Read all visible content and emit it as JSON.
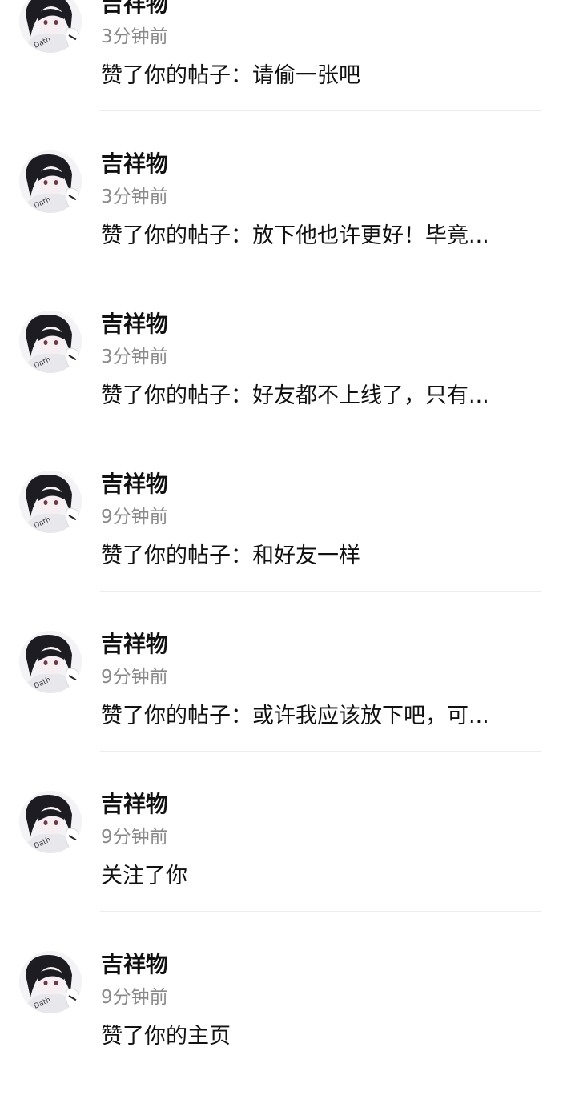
{
  "notifications": [
    {
      "name": "吉祥物",
      "time": "3分钟前",
      "message": "赞了你的帖子：请偷一张吧",
      "avatar_icon": "anime-avatar-icon"
    },
    {
      "name": "吉祥物",
      "time": "3分钟前",
      "message": "赞了你的帖子：放下他也许更好！毕竟...",
      "avatar_icon": "anime-avatar-icon"
    },
    {
      "name": "吉祥物",
      "time": "3分钟前",
      "message": "赞了你的帖子：好友都不上线了，只有...",
      "avatar_icon": "anime-avatar-icon"
    },
    {
      "name": "吉祥物",
      "time": "9分钟前",
      "message": "赞了你的帖子：和好友一样",
      "avatar_icon": "anime-avatar-icon"
    },
    {
      "name": "吉祥物",
      "time": "9分钟前",
      "message": "赞了你的帖子：或许我应该放下吧，可...",
      "avatar_icon": "anime-avatar-icon"
    },
    {
      "name": "吉祥物",
      "time": "9分钟前",
      "message": "关注了你",
      "avatar_icon": "anime-avatar-icon"
    },
    {
      "name": "吉祥物",
      "time": "9分钟前",
      "message": "赞了你的主页",
      "avatar_icon": "anime-avatar-icon"
    }
  ]
}
